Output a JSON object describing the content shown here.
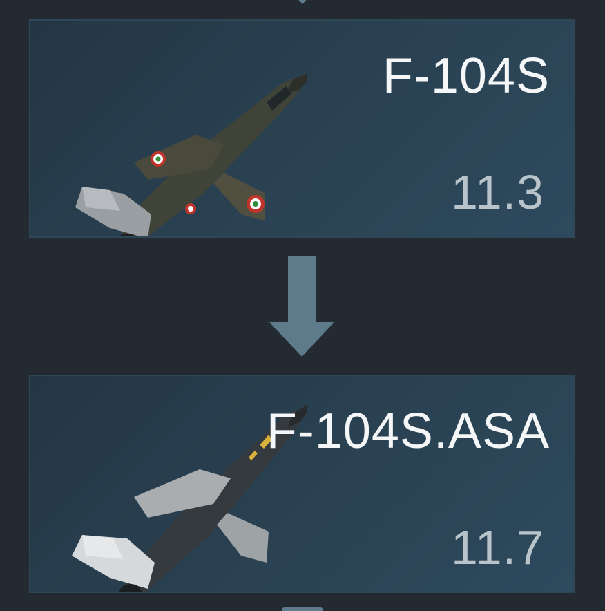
{
  "research_tree": {
    "from_vehicle": {
      "name": "F-104S",
      "battle_rating": "11.3",
      "icon": "f104s-aircraft-icon",
      "camo_colors": {
        "fuselage": "#3f4338",
        "wing": "#4a4a3c",
        "tail": "#9a9fa3",
        "roundel_outer": "#c0342c",
        "roundel_middle": "#ffffff",
        "roundel_inner": "#2f8f3a"
      }
    },
    "to_vehicle": {
      "name": "F-104S.ASA",
      "battle_rating": "11.7",
      "icon": "f104s-asa-aircraft-icon",
      "camo_colors": {
        "fuselage": "#353a3e",
        "wing": "#a9adb0",
        "tail": "#d6d9db",
        "stripe": "#d8b23a"
      }
    },
    "arrow_icon": "arrow-down-icon",
    "colors": {
      "background": "#232a31",
      "card_border": "#2f4657",
      "arrow": "#5e7b8b",
      "name_text": "#f4f6f7",
      "br_text": "#b9c4ca"
    }
  }
}
